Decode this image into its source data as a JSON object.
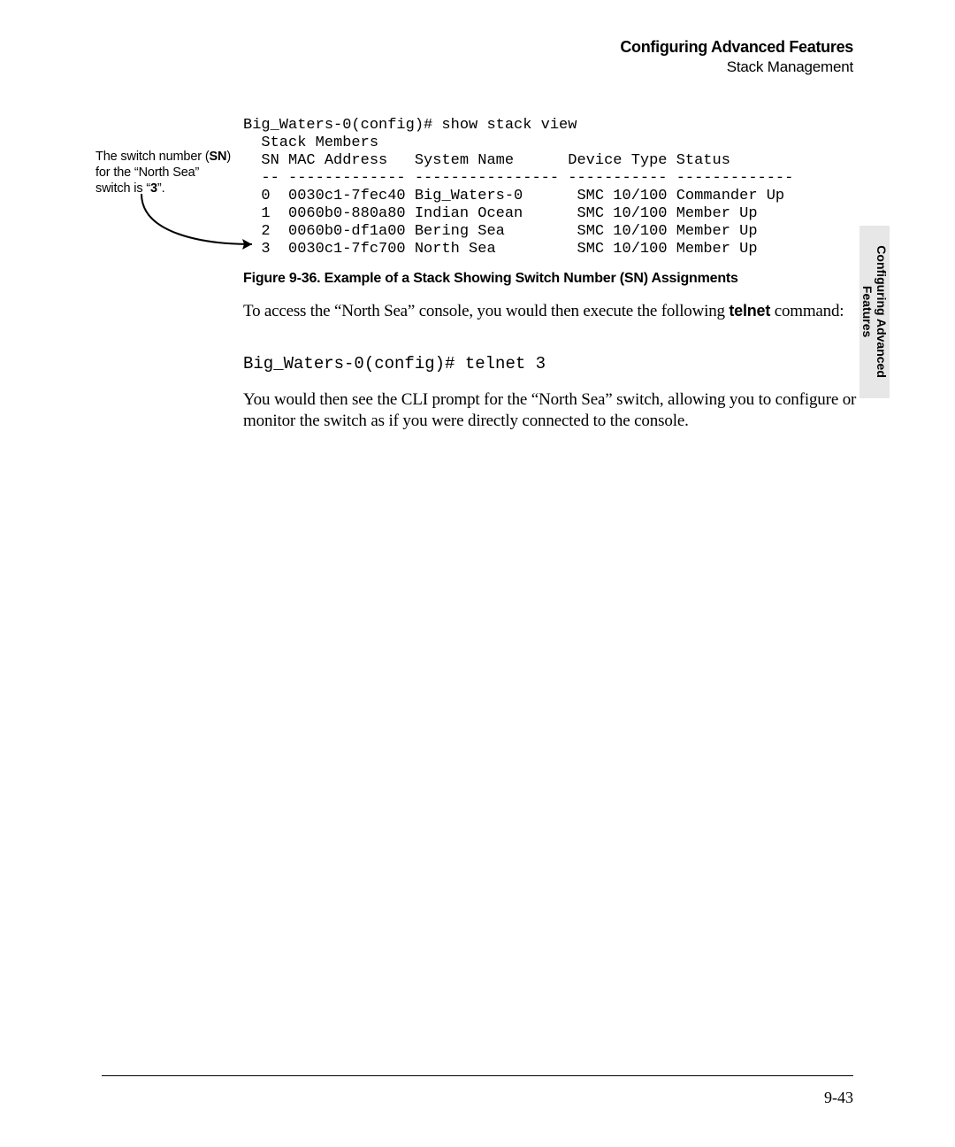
{
  "header": {
    "title": "Configuring Advanced Features",
    "subtitle": "Stack Management"
  },
  "side_tab": {
    "line1": "Configuring Advanced",
    "line2": "Features"
  },
  "callout": {
    "l1_pre": "The switch number (",
    "l1_bold": "SN",
    "l1_post": ") for the “North Sea” switch is “",
    "l1_num": "3",
    "l1_end": "”."
  },
  "cli": {
    "line1": "Big_Waters-0(config)# show stack view",
    "line2": "  Stack Members",
    "columns": {
      "sn": "SN",
      "mac": "MAC Address",
      "name": "System Name",
      "type": "Device Type",
      "status": "Status"
    },
    "dashes": {
      "sn": "--",
      "mac": "-------------",
      "name": "----------------",
      "type": "-----------",
      "status": "-------------"
    },
    "rows": [
      {
        "sn": "0",
        "mac": "0030c1-7fec40",
        "name": "Big_Waters-0",
        "type": "SMC 10/100",
        "status": "Commander Up"
      },
      {
        "sn": "1",
        "mac": "0060b0-880a80",
        "name": "Indian Ocean",
        "type": "SMC 10/100",
        "status": "Member Up"
      },
      {
        "sn": "2",
        "mac": "0060b0-df1a00",
        "name": "Bering Sea",
        "type": "SMC 10/100",
        "status": "Member Up"
      },
      {
        "sn": "3",
        "mac": "0030c1-7fc700",
        "name": "North Sea",
        "type": "SMC 10/100",
        "status": "Member Up"
      }
    ]
  },
  "figure_caption": "Figure 9-36.  Example of a Stack Showing Switch Number (SN) Assignments",
  "para1_a": "To access the “North Sea” console, you would then execute the following ",
  "para1_telnet": "telnet",
  "para1_b": " command:",
  "cmdline": "Big_Waters-0(config)# telnet 3",
  "para2": "You would then see the CLI prompt for the “North Sea” switch, allowing you to configure or monitor the switch as if you were directly connected to the console.",
  "page_number": "9-43"
}
